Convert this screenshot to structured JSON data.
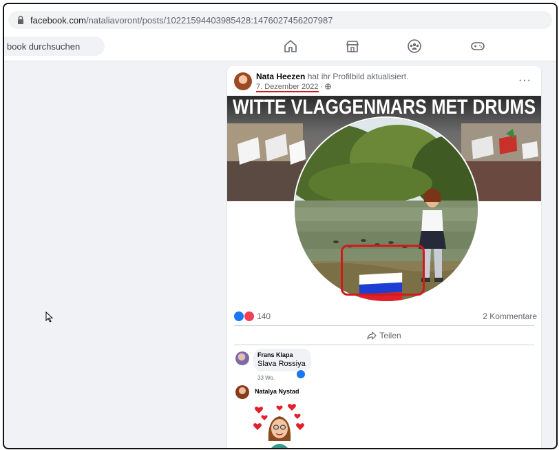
{
  "browser": {
    "url_host": "facebook.com",
    "url_path": "/nataliavoront/posts/10221594403985428:1476027456207987"
  },
  "nav": {
    "search_placeholder": "book durchsuchen",
    "icons": [
      "home-icon",
      "marketplace-icon",
      "groups-icon",
      "gaming-icon"
    ]
  },
  "post": {
    "author": "Nata Heezen",
    "action": " hat ihr Profilbild aktualisiert.",
    "date": "7. Dezember 2022",
    "privacy_separator": " · ",
    "more_label": "···",
    "banner_text": "WITTE VLAGGENMARS MET DRUMS",
    "reaction_count": "140",
    "comments_count": "2 Kommentare",
    "share_label": "Teilen"
  },
  "comments": [
    {
      "name": "Frans Klapa",
      "text": "Slava Rossiya",
      "time": "33 Wo."
    },
    {
      "name": "Natalya Nystad"
    }
  ],
  "colors": {
    "highlight": "#d11a1a",
    "like_blue": "#1877f2",
    "love_red": "#f33e58"
  }
}
